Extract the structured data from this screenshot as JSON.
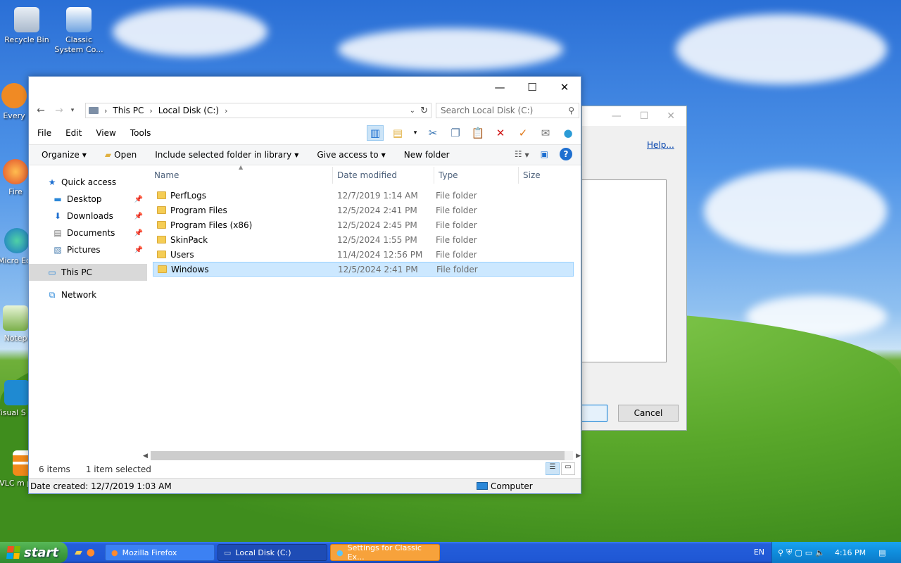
{
  "desktop": {
    "icons": [
      {
        "label": "Recycle Bin"
      },
      {
        "label": "Classic System Co..."
      },
      {
        "label": "Every"
      },
      {
        "label": "Fire"
      },
      {
        "label": "Micro Edg"
      },
      {
        "label": "Notep"
      },
      {
        "label": "Visual S Co"
      },
      {
        "label": "VLC m player"
      }
    ]
  },
  "background_dialog": {
    "help_link": "Help...",
    "cancel_label": "Cancel"
  },
  "explorer": {
    "window_controls": {
      "minimize": "—",
      "maximize": "☐",
      "close": "✕"
    },
    "address": {
      "segments": [
        "This PC",
        "Local Disk (C:)"
      ],
      "search_placeholder": "Search Local Disk (C:)"
    },
    "menu": [
      "File",
      "Edit",
      "View",
      "Tools"
    ],
    "commands": {
      "organize": "Organize",
      "open": "Open",
      "include": "Include selected folder in library",
      "share": "Give access to",
      "new_folder": "New folder"
    },
    "nav": {
      "quick_access": "Quick access",
      "desktop": "Desktop",
      "downloads": "Downloads",
      "documents": "Documents",
      "pictures": "Pictures",
      "this_pc": "This PC",
      "network": "Network"
    },
    "columns": {
      "name": "Name",
      "date": "Date modified",
      "type": "Type",
      "size": "Size"
    },
    "rows": [
      {
        "name": "PerfLogs",
        "date": "12/7/2019 1:14 AM",
        "type": "File folder"
      },
      {
        "name": "Program Files",
        "date": "12/5/2024 2:41 PM",
        "type": "File folder"
      },
      {
        "name": "Program Files (x86)",
        "date": "12/5/2024 2:45 PM",
        "type": "File folder"
      },
      {
        "name": "SkinPack",
        "date": "12/5/2024 1:55 PM",
        "type": "File folder"
      },
      {
        "name": "Users",
        "date": "11/4/2024 12:56 PM",
        "type": "File folder"
      },
      {
        "name": "Windows",
        "date": "12/5/2024 2:41 PM",
        "type": "File folder"
      }
    ],
    "status": {
      "count": "6 items",
      "selected": "1 item selected"
    },
    "details": {
      "date_created": "Date created: 12/7/2019 1:03 AM",
      "location": "Computer"
    }
  },
  "taskbar": {
    "start": "start",
    "tasks": [
      {
        "label": "Mozilla Firefox"
      },
      {
        "label": "Local Disk (C:)"
      },
      {
        "label": "Settings for Classic Ex..."
      }
    ],
    "language": "EN",
    "clock": "4:16 PM"
  }
}
